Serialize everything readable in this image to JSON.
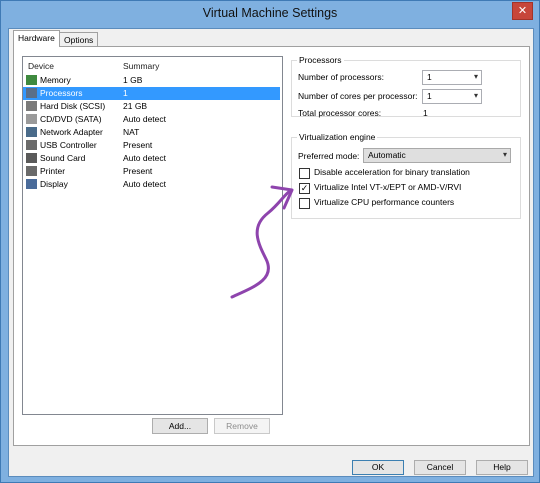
{
  "window": {
    "title": "Virtual Machine Settings",
    "close_label": "✕"
  },
  "tabs": [
    {
      "label": "Hardware"
    },
    {
      "label": "Options"
    }
  ],
  "device_list": {
    "col_device": "Device",
    "col_summary": "Summary",
    "items": [
      {
        "name": "Memory",
        "summary": "1 GB",
        "icon": "memory-icon",
        "color": "#3f8a3f"
      },
      {
        "name": "Processors",
        "summary": "1",
        "icon": "processor-icon",
        "color": "#5a6f8a"
      },
      {
        "name": "Hard Disk (SCSI)",
        "summary": "21 GB",
        "icon": "hard-disk-icon",
        "color": "#7a7a7a"
      },
      {
        "name": "CD/DVD (SATA)",
        "summary": "Auto detect",
        "icon": "cd-dvd-icon",
        "color": "#9a9a9a"
      },
      {
        "name": "Network Adapter",
        "summary": "NAT",
        "icon": "network-adapter-icon",
        "color": "#4a6b8a"
      },
      {
        "name": "USB Controller",
        "summary": "Present",
        "icon": "usb-controller-icon",
        "color": "#6a6a6a"
      },
      {
        "name": "Sound Card",
        "summary": "Auto detect",
        "icon": "sound-card-icon",
        "color": "#5a5a5a"
      },
      {
        "name": "Printer",
        "summary": "Present",
        "icon": "printer-icon",
        "color": "#6a6a6a"
      },
      {
        "name": "Display",
        "summary": "Auto detect",
        "icon": "display-icon",
        "color": "#4a6b9a"
      }
    ],
    "selected": "Processors",
    "add_label": "Add...",
    "remove_label": "Remove"
  },
  "processors_group": {
    "legend": "Processors",
    "num_processors_label": "Number of processors:",
    "num_processors_value": "1",
    "cores_label": "Number of cores per processor:",
    "cores_value": "1",
    "total_label": "Total processor cores:",
    "total_value": "1"
  },
  "virtualization_group": {
    "legend": "Virtualization engine",
    "preferred_mode_label": "Preferred mode:",
    "preferred_mode_value": "Automatic",
    "options": [
      {
        "label": "Disable acceleration for binary translation",
        "checked": false
      },
      {
        "label": "Virtualize Intel VT-x/EPT or AMD-V/RVI",
        "checked": true
      },
      {
        "label": "Virtualize CPU performance counters",
        "checked": false
      }
    ]
  },
  "footer": {
    "ok": "OK",
    "cancel": "Cancel",
    "help": "Help"
  },
  "colors": {
    "accent": "#3399ff",
    "annotation": "#8e44ad",
    "title_bar": "#7fb0e0"
  }
}
